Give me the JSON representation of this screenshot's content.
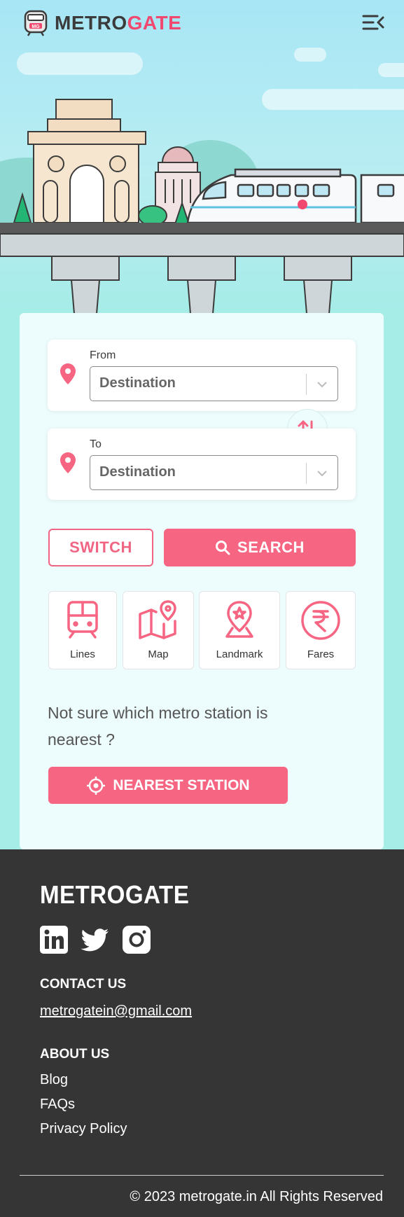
{
  "header": {
    "brand_part1": "METRO",
    "brand_part2": "GATE",
    "logo_badge": "MG"
  },
  "search": {
    "from_label": "From",
    "from_value": "Destination",
    "to_label": "To",
    "to_value": "Destination",
    "switch_label": "SWITCH",
    "search_label": "SEARCH"
  },
  "quick_links": [
    {
      "label": "Lines",
      "icon": "train-icon"
    },
    {
      "label": "Map",
      "icon": "map-icon"
    },
    {
      "label": "Landmark",
      "icon": "landmark-icon"
    },
    {
      "label": "Fares",
      "icon": "rupee-icon"
    }
  ],
  "nearest": {
    "prompt": "Not sure which metro station is nearest ?",
    "button_label": "NEAREST STATION"
  },
  "footer": {
    "logo": "METROGATE",
    "socials": [
      "linkedin-icon",
      "twitter-icon",
      "instagram-icon"
    ],
    "contact_heading": "CONTACT US",
    "email": "metrogatein@gmail.com",
    "about_heading": "ABOUT US",
    "links": [
      "Blog",
      "FAQs",
      "Privacy Policy"
    ],
    "copyright": "© 2023 metrogate.in All Rights Reserved"
  },
  "colors": {
    "accent": "#f66582",
    "brand_dark": "#3b3b3b",
    "background": "#a6ece7",
    "card": "#edfcfc",
    "footer": "#353535"
  }
}
